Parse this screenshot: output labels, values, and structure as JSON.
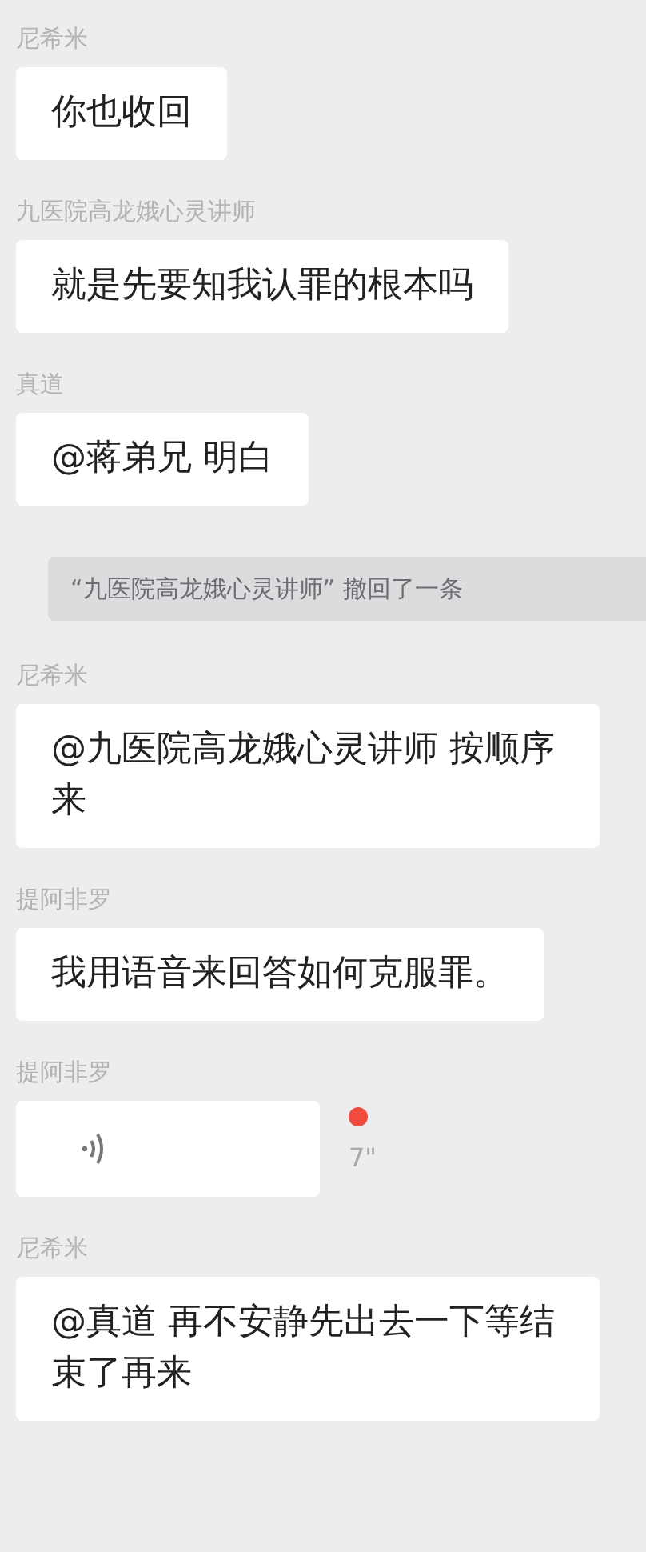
{
  "messages": [
    {
      "kind": "text",
      "sender": "尼希米",
      "text": "你也收回"
    },
    {
      "kind": "text",
      "sender": "九医院高龙娥心灵讲师",
      "text": "就是先要知我认罪的根本吗"
    },
    {
      "kind": "text",
      "sender": "真道",
      "text": "@蒋弟兄 明白"
    },
    {
      "kind": "notice",
      "text": "“九医院高龙娥心灵讲师” 撤回了一条"
    },
    {
      "kind": "text",
      "sender": "尼希米",
      "text": "@九医院高龙娥心灵讲师 按顺序来"
    },
    {
      "kind": "text",
      "sender": "提阿非罗",
      "text": "我用语音来回答如何克服罪。"
    },
    {
      "kind": "voice",
      "sender": "提阿非罗",
      "duration": "7\"",
      "unread": true
    },
    {
      "kind": "text",
      "sender": "尼希米",
      "text": "@真道 再不安静先出去一下等结束了再来"
    }
  ]
}
